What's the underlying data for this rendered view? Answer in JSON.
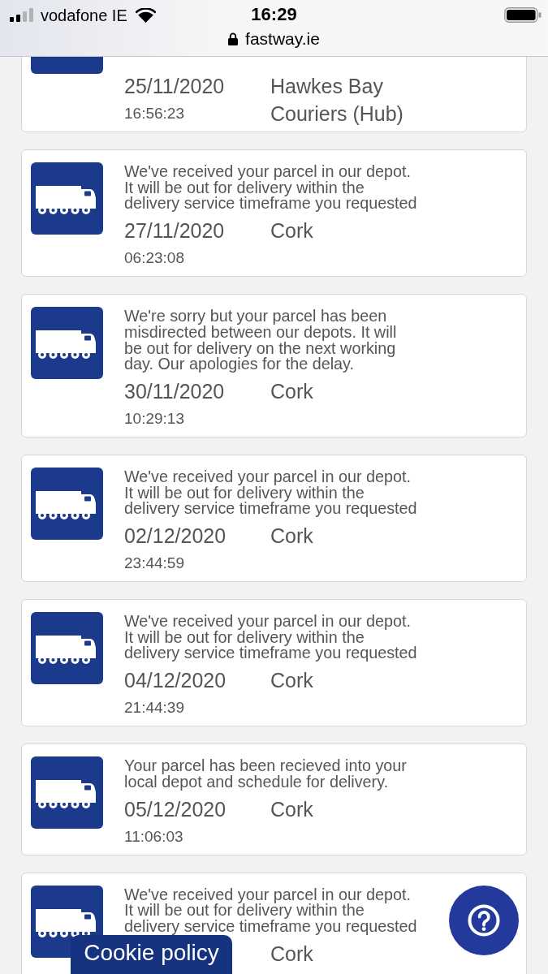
{
  "status_bar": {
    "carrier": "vodafone IE",
    "time": "16:29",
    "url": "fastway.ie"
  },
  "tracking_events": [
    {
      "date": "25/11/2020",
      "time": "16:56:23",
      "location": "Hawkes Bay Couriers (Hub)"
    },
    {
      "message": "We've received your parcel in our depot.\nIt will be out for delivery within the\ndelivery service timeframe you requested",
      "date": "27/11/2020",
      "time": "06:23:08",
      "location": "Cork"
    },
    {
      "message": "We're sorry but your parcel has been\nmisdirected between our depots. It will\nbe out for delivery on the next working\nday. Our apologies for the delay.",
      "date": "30/11/2020",
      "time": "10:29:13",
      "location": "Cork"
    },
    {
      "message": "We've received your parcel in our depot.\nIt will be out for delivery within the\ndelivery service timeframe you requested",
      "date": "02/12/2020",
      "time": "23:44:59",
      "location": "Cork"
    },
    {
      "message": "We've received your parcel in our depot.\nIt will be out for delivery within the\ndelivery service timeframe you requested",
      "date": "04/12/2020",
      "time": "21:44:39",
      "location": "Cork"
    },
    {
      "message": "Your parcel has been recieved into your\nlocal depot and schedule for delivery.",
      "date": "05/12/2020",
      "time": "11:06:03",
      "location": "Cork"
    },
    {
      "message": "We've received your parcel in our depot.\nIt will be out for delivery within the\ndelivery service timeframe you requested",
      "location": "Cork"
    }
  ],
  "cookie_button": {
    "label": "Cookie policy"
  }
}
